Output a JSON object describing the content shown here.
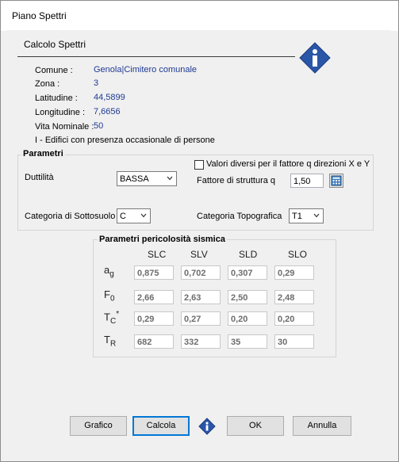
{
  "window": {
    "title": "Piano Spettri"
  },
  "header": {
    "title": "Calcolo Spettri"
  },
  "info": {
    "comune_label": "Comune :",
    "comune_value": "Genola|Cimitero comunale",
    "zona_label": "Zona :",
    "zona_value": "3",
    "latitudine_label": "Latitudine :",
    "latitudine_value": "44,5899",
    "longitudine_label": "Longitudine :",
    "longitudine_value": "7,6656",
    "vita_label": "Vita Nominale :",
    "vita_value": "50",
    "classe_text": "I - Edifici con presenza occasionale di persone"
  },
  "parametri": {
    "title": "Parametri",
    "duttilita_label": "Duttilità",
    "duttilita_value": "BASSA",
    "valori_diversi_label": "Valori diversi per il fattore q direzioni X e Y",
    "valori_diversi_checked": false,
    "fattore_label": "Fattore di struttura q",
    "fattore_value": "1,50",
    "sottosuolo_label": "Categoria di Sottosuolo",
    "sottosuolo_value": "C",
    "topografica_label": "Categoria Topografica",
    "topografica_value": "T1"
  },
  "sismica": {
    "title": "Parametri pericolosità sismica",
    "columns": [
      "SLC",
      "SLV",
      "SLD",
      "SLO"
    ],
    "rows": [
      {
        "symbol": "a",
        "sub": "g",
        "sup": "",
        "values": [
          "0,875",
          "0,702",
          "0,307",
          "0,29"
        ]
      },
      {
        "symbol": "F",
        "sub": "0",
        "sup": "",
        "values": [
          "2,66",
          "2,63",
          "2,50",
          "2,48"
        ]
      },
      {
        "symbol": "T",
        "sub": "C",
        "sup": "*",
        "values": [
          "0,29",
          "0,27",
          "0,20",
          "0,20"
        ]
      },
      {
        "symbol": "T",
        "sub": "R",
        "sup": "",
        "values": [
          "682",
          "332",
          "35",
          "30"
        ]
      }
    ]
  },
  "buttons": {
    "grafico": "Grafico",
    "calcola": "Calcola",
    "ok": "OK",
    "annulla": "Annulla"
  }
}
